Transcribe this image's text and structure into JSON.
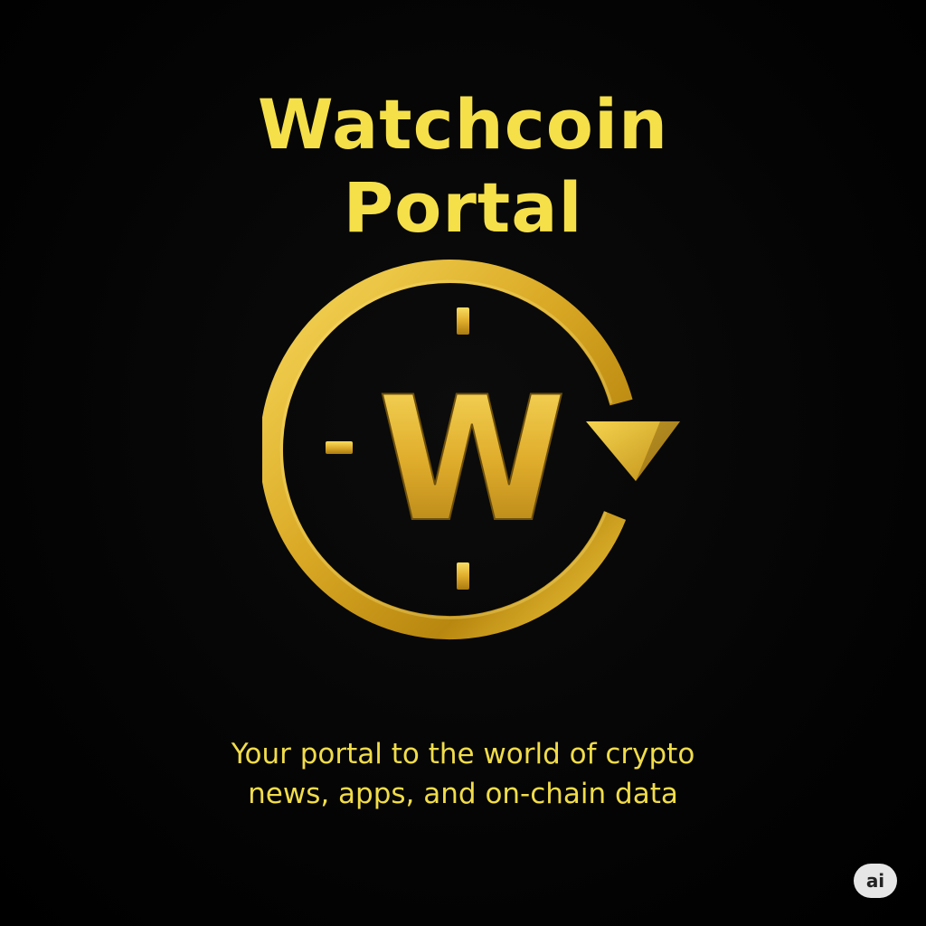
{
  "brand": {
    "title_line1": "Watchcoin",
    "title_line2": "Portal",
    "logo_letter": "W",
    "tagline_line1": "Your portal to the world of crypto",
    "tagline_line2": "news, apps, and on-chain data"
  },
  "badge": {
    "label": "ai"
  },
  "colors": {
    "background": "#050505",
    "title_yellow": "#f6e04a",
    "gold_light": "#f7d85a",
    "gold_mid": "#d9a824",
    "gold_dark": "#8a6410",
    "badge_bg": "#e6e6e6"
  },
  "icons": {
    "logo": "clock-refresh-w-logo-icon"
  }
}
